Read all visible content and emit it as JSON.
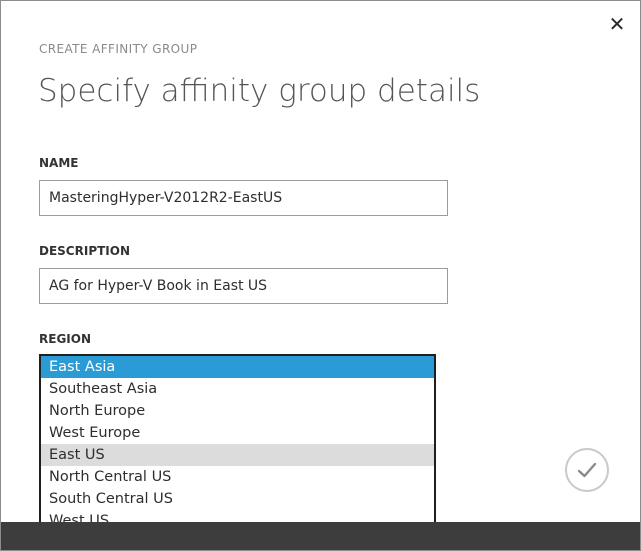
{
  "dialog": {
    "subtitle": "CREATE AFFINITY GROUP",
    "title": "Specify affinity group details",
    "close_icon": "close-icon",
    "confirm_icon": "checkmark-icon"
  },
  "name_field": {
    "label": "NAME",
    "value": "MasteringHyper-V2012R2-EastUS"
  },
  "description_field": {
    "label": "DESCRIPTION",
    "value": "AG for Hyper-V Book in East US"
  },
  "region_field": {
    "label": "REGION",
    "selected": "East Asia",
    "hovered": "East US",
    "options": [
      "East Asia",
      "Southeast Asia",
      "North Europe",
      "West Europe",
      "East US",
      "North Central US",
      "South Central US",
      "West US"
    ]
  },
  "colors": {
    "selected_option": "#2b9bd6",
    "hovered_option": "#dcdcdc",
    "bottom_bar": "#3d3d3d"
  }
}
